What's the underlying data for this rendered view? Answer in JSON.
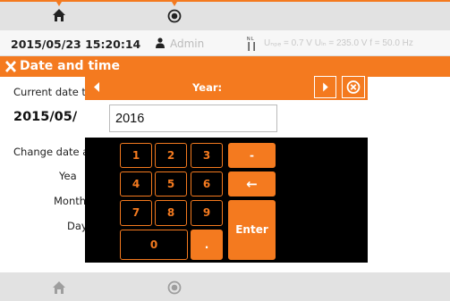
{
  "statusbar": {
    "datetime": "2015/05/23 15:20:14",
    "user": "Admin",
    "measurement": "Uₙₚₑ = 0.7 V Uₗₙ = 235.0 V f = 50.0 Hz"
  },
  "screen": {
    "title": "Date and time",
    "current_label": "Current date t",
    "current_value": "2015/05/",
    "change_label": "Change date a",
    "year_label": "Yea",
    "month_label": "Month",
    "day_label": "Day"
  },
  "dialog": {
    "title": "Year:",
    "value": "2016",
    "keys": {
      "k1": "1",
      "k2": "2",
      "k3": "3",
      "k4": "4",
      "k5": "5",
      "k6": "6",
      "k7": "7",
      "k8": "8",
      "k9": "9",
      "k0": "0",
      "dot": ".",
      "minus": "-",
      "backspace": "←",
      "enter": "Enter"
    }
  },
  "colors": {
    "accent": "#f47a1f"
  },
  "icons": [
    "home-icon",
    "back-icon",
    "user-icon",
    "nl-icon",
    "tools-icon",
    "prev-icon",
    "next-icon",
    "close-icon"
  ]
}
